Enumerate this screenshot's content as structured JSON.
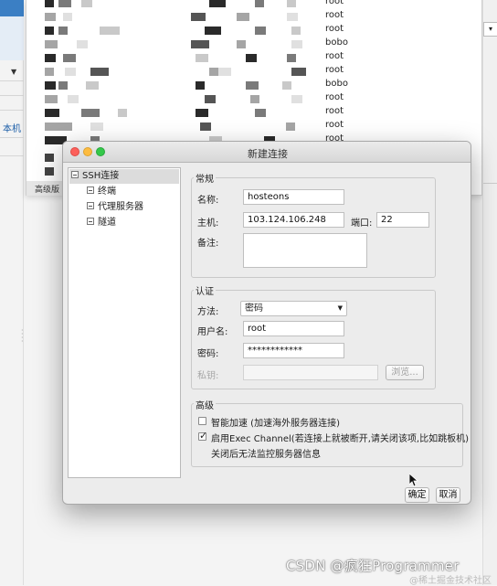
{
  "background_list": {
    "owners": [
      "root",
      "root",
      "root",
      "bobo",
      "root",
      "root",
      "bobo",
      "root",
      "root",
      "root",
      "root"
    ],
    "footer_tab": "高级版",
    "side_label": "本机"
  },
  "dialog": {
    "title": "新建连接",
    "tree": {
      "root": "SSH连接",
      "children": [
        "终端",
        "代理服务器",
        "隧道"
      ]
    },
    "general": {
      "title": "常规",
      "name_label": "名称:",
      "name_value": "hosteons",
      "host_label": "主机:",
      "host_value": "103.124.106.248",
      "port_label": "端口:",
      "port_value": "22",
      "note_label": "备注:",
      "note_value": ""
    },
    "auth": {
      "title": "认证",
      "method_label": "方法:",
      "method_value": "密码",
      "user_label": "用户名:",
      "user_value": "root",
      "password_label": "密码:",
      "password_value": "************",
      "key_label": "私钥:",
      "key_value": "",
      "browse_label": "浏览..."
    },
    "advanced": {
      "title": "高级",
      "smart_accel_label": "智能加速 (加速海外服务器连接)",
      "smart_accel_checked": false,
      "exec_channel_label": "启用Exec Channel(若连接上就被断开,请关闭该项,比如跳板机)",
      "exec_channel_checked": true,
      "exec_channel_note": "关闭后无法监控服务器信息"
    },
    "ok_label": "确定",
    "cancel_label": "取消"
  },
  "watermark": "CSDN @疯狂Programmer",
  "watermark_sub": "@稀土掘金技术社区"
}
